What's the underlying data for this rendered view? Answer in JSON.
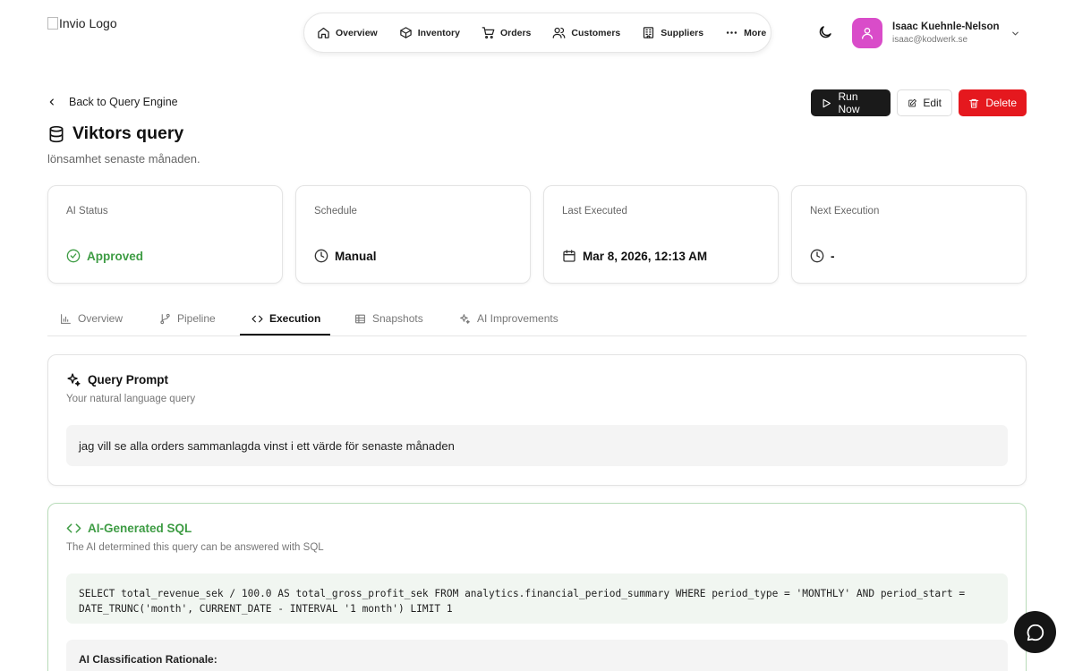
{
  "header": {
    "logo_alt": "Invio Logo",
    "nav": [
      "Overview",
      "Inventory",
      "Orders",
      "Customers",
      "Suppliers",
      "More"
    ],
    "user": {
      "name": "Isaac Kuehnle-Nelson",
      "email": "isaac@kodwerk.se"
    }
  },
  "page": {
    "back_label": "Back to Query Engine",
    "title": "Viktors query",
    "subtitle": "lönsamhet senaste månaden.",
    "actions": {
      "run": "Run Now",
      "edit": "Edit",
      "delete": "Delete"
    }
  },
  "stats": [
    {
      "label": "AI Status",
      "value": "Approved",
      "icon": "check-circle-icon"
    },
    {
      "label": "Schedule",
      "value": "Manual",
      "icon": "clock-icon"
    },
    {
      "label": "Last Executed",
      "value": "Mar 8, 2026, 12:13 AM",
      "icon": "calendar-icon"
    },
    {
      "label": "Next Execution",
      "value": "-",
      "icon": "clock-icon"
    }
  ],
  "tabs": [
    "Overview",
    "Pipeline",
    "Execution",
    "Snapshots",
    "AI Improvements"
  ],
  "active_tab": "Execution",
  "prompt_panel": {
    "title": "Query Prompt",
    "subtitle": "Your natural language query",
    "prompt": "jag vill se alla orders sammanlagda vinst i ett värde för senaste månaden"
  },
  "sql_panel": {
    "title": "AI-Generated SQL",
    "subtitle": "The AI determined this query can be answered with SQL",
    "sql": "SELECT total_revenue_sek / 100.0 AS total_gross_profit_sek FROM analytics.financial_period_summary WHERE period_type = 'MONTHLY' AND period_start = DATE_TRUNC('month', CURRENT_DATE - INTERVAL '1 month') LIMIT 1",
    "rationale_label": "AI Classification Rationale:"
  },
  "colors": {
    "accent_green": "#3e9c44",
    "danger": "#e5181e",
    "primary": "#1a1a1a",
    "avatar": "#d94cc9"
  }
}
